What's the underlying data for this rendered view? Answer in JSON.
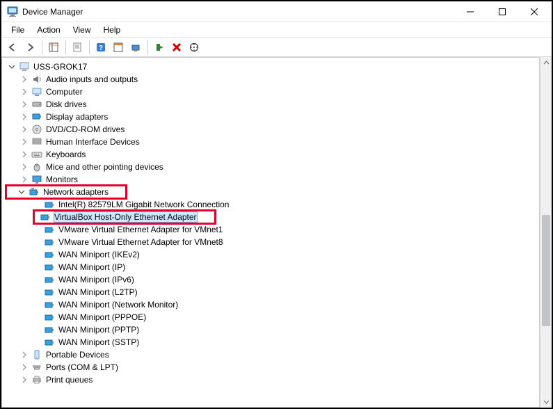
{
  "window": {
    "title": "Device Manager"
  },
  "menu": {
    "file": "File",
    "action": "Action",
    "view": "View",
    "help": "Help"
  },
  "tree": {
    "root": {
      "label": "USS-GROK17"
    },
    "cat_audio": "Audio inputs and outputs",
    "cat_computer": "Computer",
    "cat_disk": "Disk drives",
    "cat_display": "Display adapters",
    "cat_dvd": "DVD/CD-ROM drives",
    "cat_hid": "Human Interface Devices",
    "cat_keyboards": "Keyboards",
    "cat_mice": "Mice and other pointing devices",
    "cat_monitors": "Monitors",
    "cat_network": "Network adapters",
    "net": {
      "intel": "Intel(R) 82579LM Gigabit Network Connection",
      "vbox": "VirtualBox Host-Only Ethernet Adapter",
      "vmnet1": "VMware Virtual Ethernet Adapter for VMnet1",
      "vmnet8": "VMware Virtual Ethernet Adapter for VMnet8",
      "wan_ikev2": "WAN Miniport (IKEv2)",
      "wan_ip": "WAN Miniport (IP)",
      "wan_ipv6": "WAN Miniport (IPv6)",
      "wan_l2tp": "WAN Miniport (L2TP)",
      "wan_netmon": "WAN Miniport (Network Monitor)",
      "wan_pppoe": "WAN Miniport (PPPOE)",
      "wan_pptp": "WAN Miniport (PPTP)",
      "wan_sstp": "WAN Miniport (SSTP)"
    },
    "cat_portable": "Portable Devices",
    "cat_ports": "Ports (COM & LPT)",
    "cat_printq": "Print queues"
  }
}
